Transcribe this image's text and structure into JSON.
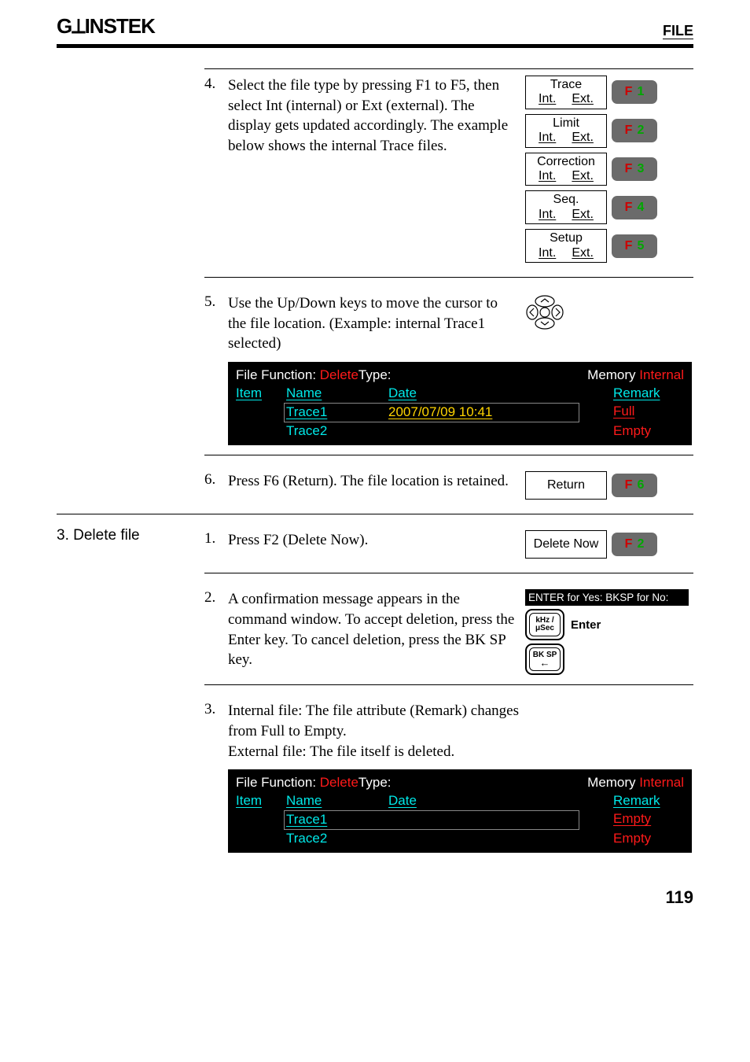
{
  "header": {
    "logo": "GWINSTEK",
    "section": "FILE"
  },
  "fkeys": {
    "f1": {
      "top": "Trace",
      "left": "Int.",
      "right": "Ext.",
      "btn": "1"
    },
    "f2": {
      "top": "Limit",
      "left": "Int.",
      "right": "Ext.",
      "btn": "2"
    },
    "f3": {
      "top": "Correction",
      "left": "Int.",
      "right": "Ext.",
      "btn": "3"
    },
    "f4": {
      "top": "Seq.",
      "left": "Int.",
      "right": "Ext.",
      "btn": "4"
    },
    "f5": {
      "top": "Setup",
      "left": "Int.",
      "right": "Ext.",
      "btn": "5"
    },
    "f6": {
      "label": "Return",
      "btn": "6"
    },
    "f2b": {
      "label": "Delete Now",
      "btn": "2"
    }
  },
  "step4": {
    "num": "4.",
    "text": "Select the file type by pressing F1 to F5, then select Int (internal) or Ext (external). The display gets updated accordingly. The example below shows the internal Trace files."
  },
  "step5": {
    "num": "5.",
    "text": "Use the Up/Down keys to move the cursor to the file location. (Example: internal Trace1 selected)"
  },
  "lcd1": {
    "func_label": "File Function",
    "func_value": "Delete",
    "type_label": "Type:",
    "mem_label": "Memory",
    "mem_value": "Internal",
    "h_item": "Item",
    "h_name": "Name",
    "h_date": "Date",
    "h_remark": "Remark",
    "r1_name": "Trace1",
    "r1_date": "2007/07/09 10:41",
    "r1_remark": "Full",
    "r2_name": "Trace2",
    "r2_remark": "Empty"
  },
  "step6": {
    "num": "6.",
    "text": "Press F6 (Return). The file location is retained."
  },
  "section3": {
    "heading": "3. Delete file"
  },
  "d1": {
    "num": "1.",
    "text": "Press F2 (Delete Now)."
  },
  "d2": {
    "num": "2.",
    "text": "A confirmation message appears in the command window. To accept deletion, press the Enter key. To cancel deletion, press the BK SP key.",
    "bar": "ENTER for Yes: BKSP for No:",
    "key1_top": "kHz /",
    "key1_bot": "μSec",
    "enter": "Enter",
    "key2": "BK SP"
  },
  "d3": {
    "num": "3.",
    "text": "Internal file: The file attribute (Remark) changes from Full to Empty.\nExternal file: The file itself is deleted."
  },
  "lcd2": {
    "func_label": "File Function",
    "func_value": "Delete",
    "type_label": "Type:",
    "mem_label": "Memory",
    "mem_value": "Internal",
    "h_item": "Item",
    "h_name": "Name",
    "h_date": "Date",
    "h_remark": "Remark",
    "r1_name": "Trace1",
    "r1_remark": "Empty",
    "r2_name": "Trace2",
    "r2_remark": "Empty"
  },
  "pagenum": "119"
}
